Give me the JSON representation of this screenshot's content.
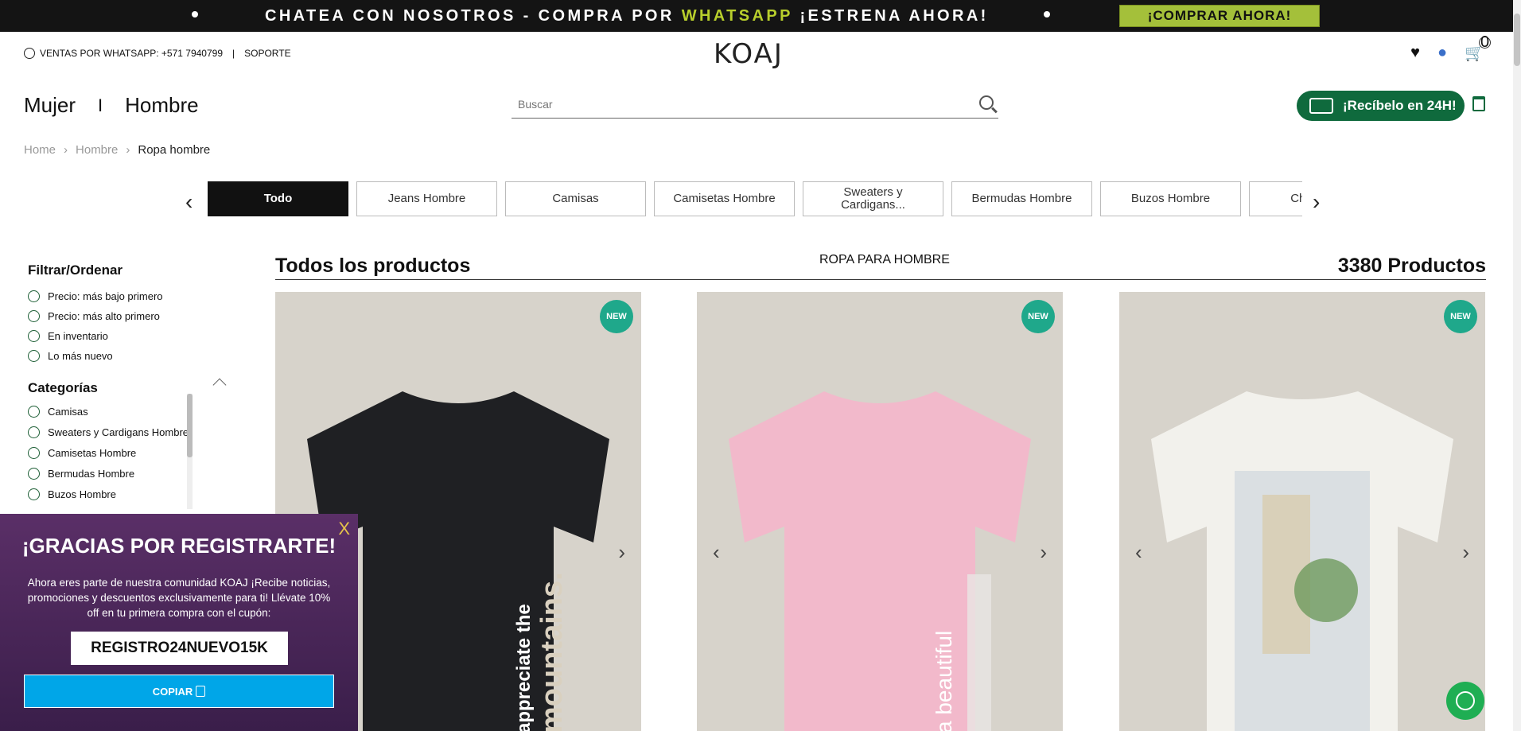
{
  "promo": {
    "text_before": "CHATEA CON NOSOTROS - COMPRA POR ",
    "text_highlight": "WHATSAPP",
    "text_after": " ¡ESTRENA AHORA!",
    "button": "¡COMPRAR AHORA!"
  },
  "topbar": {
    "whatsapp_sales": "VENTAS POR WHATSAPP: +571 7940799",
    "separator": "|",
    "support": "SOPORTE",
    "logo": "KOAJ",
    "cart_count": "0"
  },
  "nav": {
    "women": "Mujer",
    "separator": "I",
    "men": "Hombre"
  },
  "search": {
    "placeholder": "Buscar"
  },
  "delivery": {
    "label": "¡Recíbelo en 24H!"
  },
  "breadcrumb": {
    "home": "Home",
    "level1": "Hombre",
    "current": "Ropa hombre"
  },
  "categories": [
    "Todo",
    "Jeans Hombre",
    "Camisas",
    "Camisetas Hombre",
    "Sweaters y Cardigans...",
    "Bermudas Hombre",
    "Buzos Hombre",
    "Chaquetas"
  ],
  "sidebar": {
    "filter_title": "Filtrar/Ordenar",
    "filters": [
      "Precio: más bajo primero",
      "Precio: más alto primero",
      "En inventario",
      "Lo más nuevo"
    ],
    "categories_title": "Categorías",
    "categories": [
      "Camisas",
      "Sweaters y Cardigans Hombre",
      "Camisetas Hombre",
      "Bermudas Hombre",
      "Buzos Hombre"
    ]
  },
  "products": {
    "title": "Todos los productos",
    "section": "ROPA PARA HOMBRE",
    "count": "3380 Productos",
    "badge": "NEW",
    "items": [
      {
        "shirt_color": "#1f2023",
        "print_text": "appreciate the mountains.",
        "print_color": "#d9d0bf"
      },
      {
        "shirt_color": "#f2b9cb",
        "print_text": "a beautiful",
        "print_color": "#ffffff"
      },
      {
        "shirt_color": "#f2f1ec",
        "print_text": "",
        "print_color": "#7a8a9a"
      }
    ]
  },
  "popup": {
    "close": "X",
    "title": "¡GRACIAS POR REGISTRARTE!",
    "body": "Ahora eres parte de nuestra comunidad KOAJ ¡Recibe noticias, promociones y descuentos exclusivamente para ti! Llévate 10% off en tu primera compra con el cupón:",
    "coupon": "REGISTRO24NUEVO15K",
    "copy_button": "COPIAR"
  },
  "colors": {
    "brand_green": "#0f6a3d",
    "promo_green": "#a4c03a",
    "badge_green": "#1fa88b",
    "popup_purple": "#4a2758",
    "copy_blue": "#00a6e8",
    "whatsapp": "#1fae53"
  },
  "icons": [
    "whatsapp-icon",
    "heart-icon",
    "user-icon",
    "cart-icon",
    "search-icon",
    "truck-icon",
    "trash-icon",
    "chevron-left-icon",
    "chevron-right-icon",
    "copy-icon"
  ]
}
